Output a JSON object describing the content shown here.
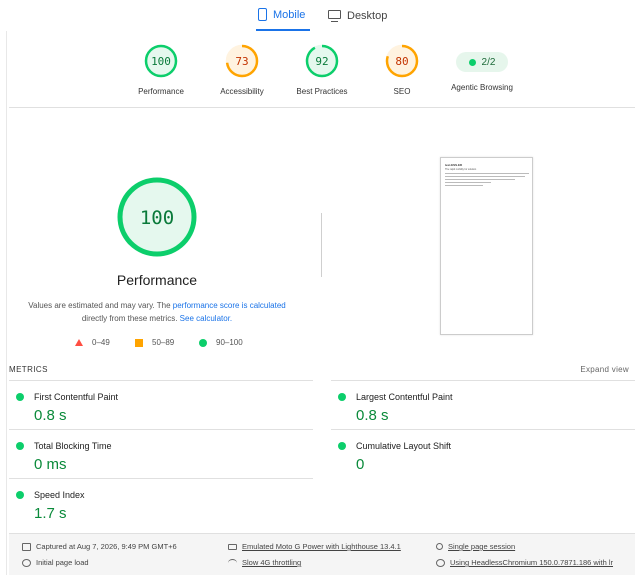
{
  "tabs": [
    {
      "label": "Mobile",
      "icon": "phone-icon",
      "active": true
    },
    {
      "label": "Desktop",
      "icon": "monitor-icon",
      "active": false
    }
  ],
  "categories": [
    {
      "label": "Performance",
      "score": "100",
      "fill": 1.0,
      "color": "#0cce6b",
      "bg": "#e5f8ee",
      "text_color": "#0a7a3a"
    },
    {
      "label": "Accessibility",
      "score": "73",
      "fill": 0.73,
      "color": "#ffa400",
      "bg": "#fff3e0",
      "text_color": "#c33300"
    },
    {
      "label": "Best Practices",
      "score": "92",
      "fill": 0.92,
      "color": "#0cce6b",
      "bg": "#e5f8ee",
      "text_color": "#0a7a3a"
    },
    {
      "label": "SEO",
      "score": "80",
      "fill": 0.8,
      "color": "#ffa400",
      "bg": "#fff3e0",
      "text_color": "#c33300"
    },
    {
      "label": "Agentic Browsing",
      "score": "2/2",
      "type": "pill"
    }
  ],
  "performance": {
    "score": "100",
    "fill": 1.0,
    "title": "Performance",
    "disclaimer_pre": "Values are estimated and may vary. The ",
    "disclaimer_link1": "performance score is calculated",
    "disclaimer_mid": " directly from these metrics. ",
    "disclaimer_link2": "See calculator.",
    "legend": [
      {
        "shape": "triangle",
        "range": "0–49"
      },
      {
        "shape": "square",
        "range": "50–89"
      },
      {
        "shape": "circle",
        "range": "90–100"
      }
    ]
  },
  "thumbnail": {
    "title": "test.ESS.ED",
    "subtitle": "The rapid mobility for solution"
  },
  "metrics": {
    "heading": "METRICS",
    "expand_label": "Expand view",
    "items": [
      {
        "name": "First Contentful Paint",
        "value": "0.8 s"
      },
      {
        "name": "Largest Contentful Paint",
        "value": "0.8 s"
      },
      {
        "name": "Total Blocking Time",
        "value": "0 ms"
      },
      {
        "name": "Cumulative Layout Shift",
        "value": "0"
      },
      {
        "name": "Speed Index",
        "value": "1.7 s"
      }
    ]
  },
  "footer": {
    "captured": "Captured at Aug 7, 2026, 9:49 PM GMT+6",
    "initial_load": "Initial page load",
    "device": "Emulated Moto G Power with Lighthouse 13.4.1",
    "throttling": "Slow 4G throttling",
    "session": "Single page session",
    "browser": "Using HeadlessChromium 150.0.7871.186 with lr"
  },
  "colors": {
    "accent": "#1a73e8",
    "pass": "#0cce6b",
    "average": "#ffa400",
    "fail": "#ff4e42"
  }
}
